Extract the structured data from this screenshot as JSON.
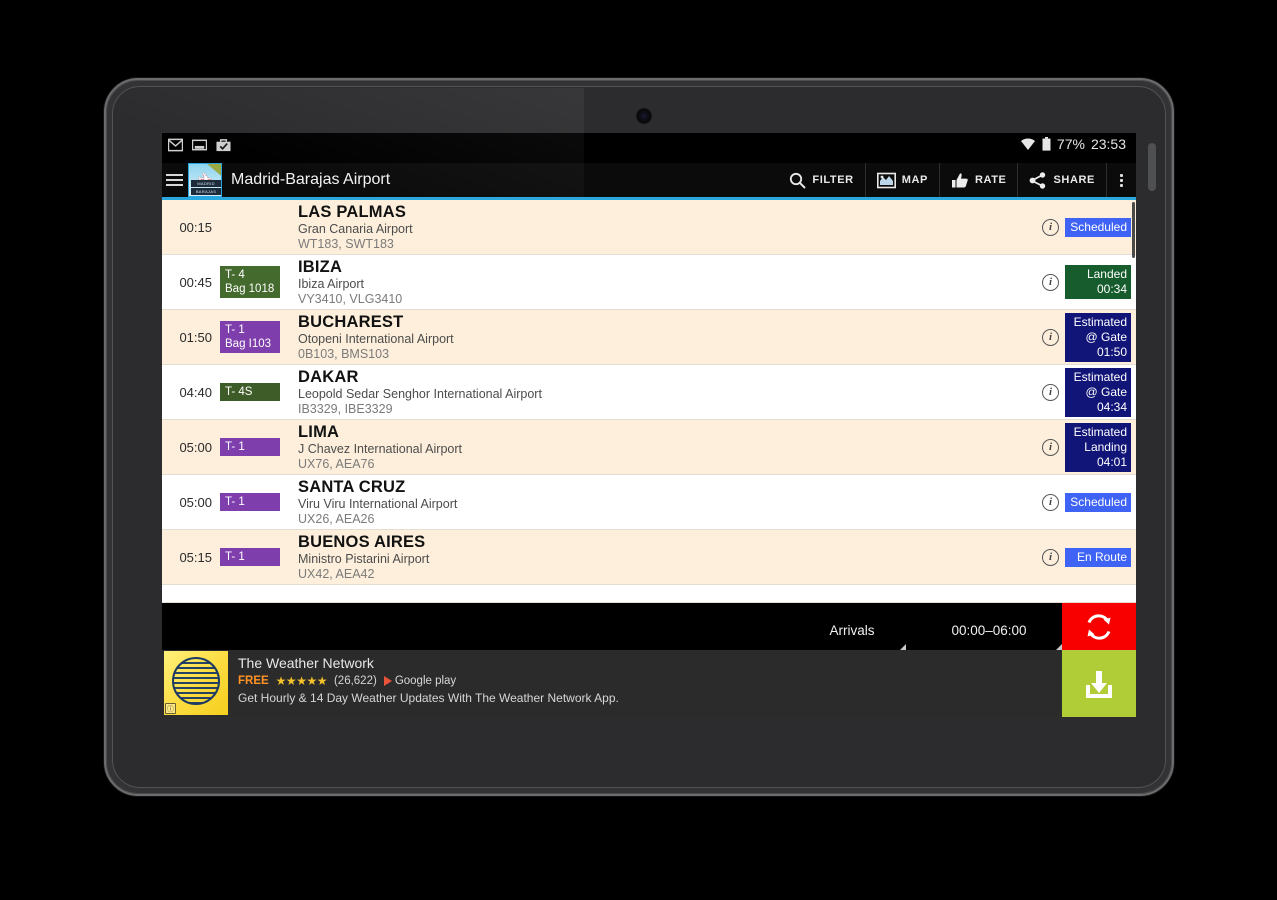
{
  "status_bar": {
    "notification_icons": [
      "mail-icon",
      "screenshot-icon",
      "briefcase-check-icon"
    ],
    "wifi_icon": "wifi-icon",
    "battery_icon": "battery-icon",
    "battery_text": "77%",
    "clock": "23:53"
  },
  "action_bar": {
    "menu_icon": "hamburger-menu-icon",
    "app_icon": "madrid-barajas-app-icon",
    "app_icon_label_top": "MADRID",
    "app_icon_label_bottom": "BARAJAS",
    "title": "Madrid-Barajas Airport",
    "actions": [
      {
        "id": "filter",
        "label": "FILTER",
        "icon": "search-icon"
      },
      {
        "id": "map",
        "label": "MAP",
        "icon": "map-icon"
      },
      {
        "id": "rate",
        "label": "RATE",
        "icon": "thumbs-up-icon"
      },
      {
        "id": "share",
        "label": "SHARE",
        "icon": "share-icon"
      }
    ],
    "overflow_icon": "overflow-menu-icon",
    "accent_color": "#29a7df"
  },
  "flights": [
    {
      "time": "00:15",
      "terminal": "",
      "terminal_color": "",
      "city": "LAS PALMAS",
      "airport": "Gran Canaria Airport",
      "codes": "WT183, SWT183",
      "status_lines": [
        "Scheduled"
      ],
      "status_type": "scheduled",
      "status_color": "#3f63f5",
      "info_icon": "info-icon"
    },
    {
      "time": "00:45",
      "terminal": "T- 4\nBag 1018",
      "terminal_color": "#456a2e",
      "city": "IBIZA",
      "airport": "Ibiza Airport",
      "codes": "VY3410, VLG3410",
      "status_lines": [
        "Landed",
        "00:34"
      ],
      "status_type": "landed",
      "status_color": "#175c2c",
      "info_icon": "info-icon"
    },
    {
      "time": "01:50",
      "terminal": "T- 1\nBag I103",
      "terminal_color": "#7e3fac",
      "city": "BUCHAREST",
      "airport": "Otopeni International Airport",
      "codes": "0B103, BMS103",
      "status_lines": [
        "Estimated",
        "@ Gate",
        "01:50"
      ],
      "status_type": "estimated",
      "status_color": "#111578",
      "info_icon": "info-icon"
    },
    {
      "time": "04:40",
      "terminal": "T- 4S",
      "terminal_color": "#3e5c27",
      "city": "DAKAR",
      "airport": "Leopold Sedar Senghor International Airport",
      "codes": "IB3329, IBE3329",
      "status_lines": [
        "Estimated",
        "@ Gate",
        "04:34"
      ],
      "status_type": "estimated",
      "status_color": "#111578",
      "info_icon": "info-icon"
    },
    {
      "time": "05:00",
      "terminal": "T- 1",
      "terminal_color": "#7e3fac",
      "city": "LIMA",
      "airport": "J Chavez International Airport",
      "codes": "UX76, AEA76",
      "status_lines": [
        "Estimated",
        "Landing",
        "04:01"
      ],
      "status_type": "estimated",
      "status_color": "#111578",
      "info_icon": "info-icon"
    },
    {
      "time": "05:00",
      "terminal": "T- 1",
      "terminal_color": "#7e3fac",
      "city": "SANTA CRUZ",
      "airport": "Viru Viru International Airport",
      "codes": "UX26, AEA26",
      "status_lines": [
        "Scheduled"
      ],
      "status_type": "scheduled",
      "status_color": "#3f63f5",
      "info_icon": "info-icon"
    },
    {
      "time": "05:15",
      "terminal": "T- 1",
      "terminal_color": "#7e3fac",
      "city": "BUENOS AIRES",
      "airport": "Ministro Pistarini Airport",
      "codes": "UX42, AEA42",
      "status_lines": [
        "En Route"
      ],
      "status_type": "enroute",
      "status_color": "#3f63f5",
      "info_icon": "info-icon"
    }
  ],
  "control_bar": {
    "direction_value": "Arrivals",
    "time_range_value": "00:00–06:00",
    "refresh_icon": "refresh-icon",
    "refresh_color": "#f80000"
  },
  "ad": {
    "icon": "weather-network-globe-icon",
    "adchoices_icon": "adchoices-icon",
    "title": "The Weather Network",
    "price": "FREE",
    "stars": "★★★★★",
    "rating_count": "(26,622)",
    "store": "Google play",
    "description": "Get Hourly & 14 Day Weather Updates With The Weather Network App.",
    "cta_icon": "download-icon",
    "cta_color": "#b0cc37"
  },
  "nav_bar": {
    "buttons": [
      {
        "id": "back",
        "icon": "back-arrow-icon"
      },
      {
        "id": "home",
        "icon": "home-icon"
      },
      {
        "id": "recents",
        "icon": "recents-icon"
      },
      {
        "id": "screenshot",
        "icon": "screenshot-recents-icon"
      },
      {
        "id": "split-screen",
        "icon": "split-screen-icon"
      }
    ]
  }
}
